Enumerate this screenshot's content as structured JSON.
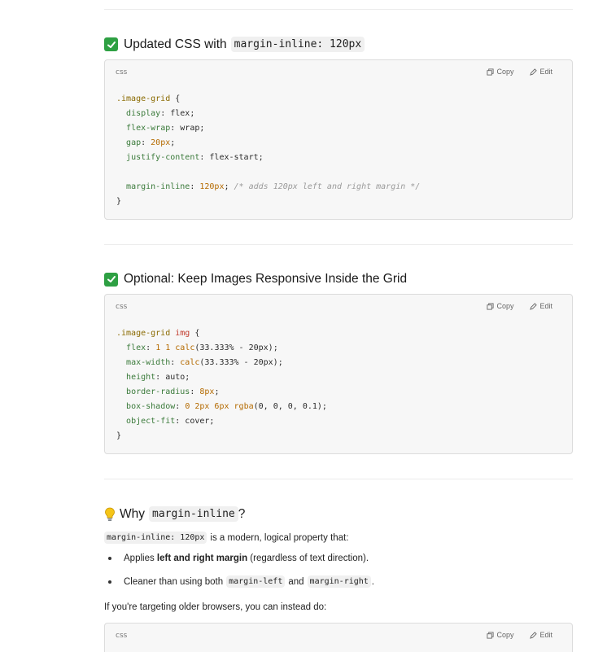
{
  "section1": {
    "heading_text": "Updated CSS with",
    "heading_code": "margin-inline: 120px",
    "code_lang": "css",
    "copy_label": "Copy",
    "edit_label": "Edit"
  },
  "section2": {
    "heading_text": "Optional: Keep Images Responsive Inside the Grid",
    "code_lang": "css",
    "copy_label": "Copy",
    "edit_label": "Edit"
  },
  "section3": {
    "heading_text": "Why",
    "heading_code": "margin-inline",
    "heading_suffix": "?",
    "para_code": "margin-inline: 120px",
    "para_text": "is a modern, logical property that:",
    "bullet1_pre": "Applies ",
    "bullet1_bold": "left and right margin",
    "bullet1_post": " (regardless of text direction).",
    "bullet2_pre": "Cleaner than using both",
    "bullet2_code1": "margin-left",
    "bullet2_mid": "and",
    "bullet2_code2": "margin-right",
    "bullet2_post": ".",
    "older_text": "If you're targeting older browsers, you can instead do:",
    "code_lang": "css",
    "copy_label": "Copy",
    "edit_label": "Edit"
  },
  "code1": {
    "l1_sel": ".image-grid",
    "l1_rest": " {",
    "l2_prop": "display",
    "l2_val": ": flex;",
    "l3_prop": "flex-wrap",
    "l3_val": ": wrap;",
    "l4_prop": "gap",
    "l4_colon": ": ",
    "l4_num": "20px",
    "l4_end": ";",
    "l5_prop": "justify-content",
    "l5_val": ": flex-start;",
    "l6_prop": "margin-inline",
    "l6_colon": ": ",
    "l6_num": "120px",
    "l6_end": "; ",
    "l6_cm": "/* adds 120px left and right margin */",
    "l7": "}"
  },
  "code2": {
    "l1_sel": ".image-grid",
    "l1_tag": "img",
    "l1_rest": " {",
    "l2_prop": "flex",
    "l2_colon": ": ",
    "l2_num": "1 1 ",
    "l2_fn": "calc",
    "l2_args": "(33.333% - 20px);",
    "l3_prop": "max-width",
    "l3_colon": ": ",
    "l3_fn": "calc",
    "l3_args": "(33.333% - 20px);",
    "l4_prop": "height",
    "l4_val": ": auto;",
    "l5_prop": "border-radius",
    "l5_colon": ": ",
    "l5_num": "8px",
    "l5_end": ";",
    "l6_prop": "box-shadow",
    "l6_colon": ": ",
    "l6_num": "0 2px 6px ",
    "l6_fn": "rgba",
    "l6_args": "(0, 0, 0, 0.1);",
    "l7_prop": "object-fit",
    "l7_val": ": cover;",
    "l8": "}"
  },
  "icons": {
    "check": "check-mark-icon",
    "bulb": "light-bulb-icon",
    "copy": "copy-icon",
    "edit": "edit-icon"
  },
  "colors": {
    "check_green": "#2ea043",
    "code_bg": "#f7f7f7",
    "inline_code_bg": "#f0f0f0"
  }
}
